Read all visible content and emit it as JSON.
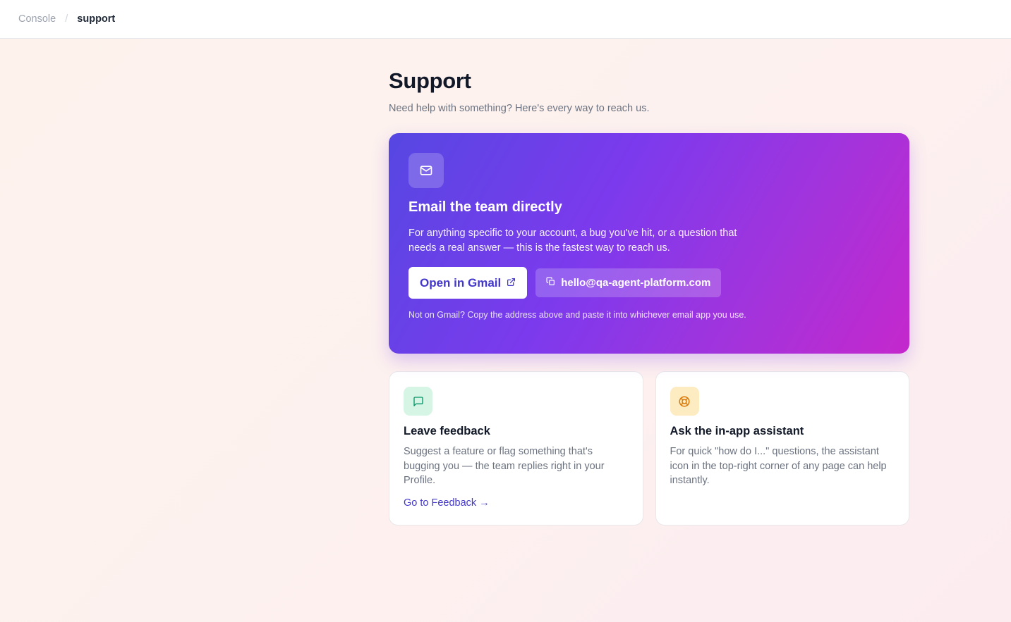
{
  "breadcrumb": {
    "root": "Console",
    "separator": "/",
    "current": "support"
  },
  "page": {
    "title": "Support",
    "subtitle": "Need help with something? Here's every way to reach us."
  },
  "email_card": {
    "icon": "mail-icon",
    "title": "Email the team directly",
    "description": "For anything specific to your account, a bug you've hit, or a question that needs a real answer — this is the fastest way to reach us.",
    "open_button_label": "Open in Gmail",
    "open_button_icon": "external-link-icon",
    "copy_button_icon": "copy-icon",
    "email_address": "hello@qa-agent-platform.com",
    "note": "Not on Gmail? Copy the address above and paste it into whichever email app you use."
  },
  "feedback_card": {
    "icon": "message-square-icon",
    "title": "Leave feedback",
    "description": "Suggest a feature or flag something that's bugging you — the team replies right in your Profile.",
    "link_label": "Go to Feedback →"
  },
  "assistant_card": {
    "icon": "life-buoy-icon",
    "title": "Ask the in-app assistant",
    "description": "For quick \"how do I...\" questions, the assistant icon in the top-right corner of any page can help instantly."
  },
  "colors": {
    "accent": "#4338ca",
    "hero_gradient_start": "#5647e2",
    "hero_gradient_end": "#c428cc",
    "feedback_icon_bg": "#d6f5e5",
    "assistant_icon_bg": "#fdebc1"
  }
}
